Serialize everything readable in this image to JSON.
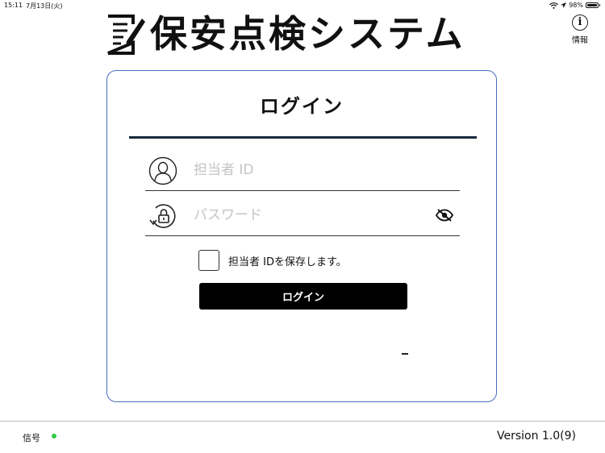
{
  "status_bar": {
    "time": "15:11",
    "date": "7月13日(火)",
    "battery_percent": "98%"
  },
  "header": {
    "app_title": "保安点検システム",
    "info_label": "情報"
  },
  "login": {
    "title": "ログイン",
    "user_id_placeholder": "担当者 ID",
    "password_placeholder": "パスワード",
    "remember_label": "担当者 IDを保存します。",
    "remember_checked": false,
    "login_button_label": "ログイン",
    "dash_text": "–"
  },
  "footer": {
    "signal_label": "信号",
    "signal_color": "#2ecc40",
    "version": "Version 1.0(9)"
  },
  "icons": {
    "logo": "document-pen-icon",
    "info": "info-circle-icon",
    "user": "user-circle-icon",
    "password": "lock-rotate-icon",
    "visibility": "eye-slash-icon",
    "wifi": "wifi-icon",
    "location": "location-arrow-icon",
    "battery": "battery-icon"
  },
  "colors": {
    "card_border": "#4a6dbf",
    "title_rule": "#1b2a3c",
    "button_bg": "#000000"
  }
}
